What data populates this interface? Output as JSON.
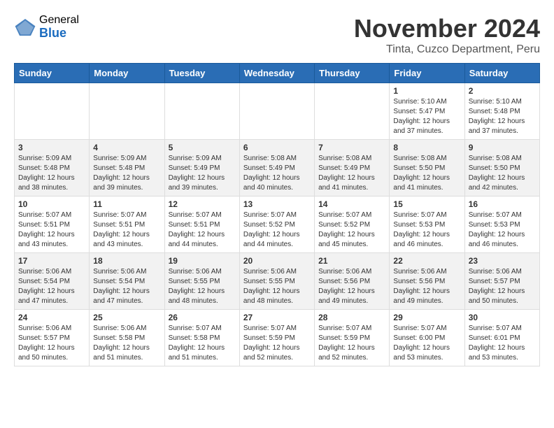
{
  "header": {
    "logo_general": "General",
    "logo_blue": "Blue",
    "title": "November 2024",
    "subtitle": "Tinta, Cuzco Department, Peru"
  },
  "weekdays": [
    "Sunday",
    "Monday",
    "Tuesday",
    "Wednesday",
    "Thursday",
    "Friday",
    "Saturday"
  ],
  "weeks": [
    [
      {
        "day": "",
        "info": ""
      },
      {
        "day": "",
        "info": ""
      },
      {
        "day": "",
        "info": ""
      },
      {
        "day": "",
        "info": ""
      },
      {
        "day": "",
        "info": ""
      },
      {
        "day": "1",
        "info": "Sunrise: 5:10 AM\nSunset: 5:47 PM\nDaylight: 12 hours\nand 37 minutes."
      },
      {
        "day": "2",
        "info": "Sunrise: 5:10 AM\nSunset: 5:48 PM\nDaylight: 12 hours\nand 37 minutes."
      }
    ],
    [
      {
        "day": "3",
        "info": "Sunrise: 5:09 AM\nSunset: 5:48 PM\nDaylight: 12 hours\nand 38 minutes."
      },
      {
        "day": "4",
        "info": "Sunrise: 5:09 AM\nSunset: 5:48 PM\nDaylight: 12 hours\nand 39 minutes."
      },
      {
        "day": "5",
        "info": "Sunrise: 5:09 AM\nSunset: 5:49 PM\nDaylight: 12 hours\nand 39 minutes."
      },
      {
        "day": "6",
        "info": "Sunrise: 5:08 AM\nSunset: 5:49 PM\nDaylight: 12 hours\nand 40 minutes."
      },
      {
        "day": "7",
        "info": "Sunrise: 5:08 AM\nSunset: 5:49 PM\nDaylight: 12 hours\nand 41 minutes."
      },
      {
        "day": "8",
        "info": "Sunrise: 5:08 AM\nSunset: 5:50 PM\nDaylight: 12 hours\nand 41 minutes."
      },
      {
        "day": "9",
        "info": "Sunrise: 5:08 AM\nSunset: 5:50 PM\nDaylight: 12 hours\nand 42 minutes."
      }
    ],
    [
      {
        "day": "10",
        "info": "Sunrise: 5:07 AM\nSunset: 5:51 PM\nDaylight: 12 hours\nand 43 minutes."
      },
      {
        "day": "11",
        "info": "Sunrise: 5:07 AM\nSunset: 5:51 PM\nDaylight: 12 hours\nand 43 minutes."
      },
      {
        "day": "12",
        "info": "Sunrise: 5:07 AM\nSunset: 5:51 PM\nDaylight: 12 hours\nand 44 minutes."
      },
      {
        "day": "13",
        "info": "Sunrise: 5:07 AM\nSunset: 5:52 PM\nDaylight: 12 hours\nand 44 minutes."
      },
      {
        "day": "14",
        "info": "Sunrise: 5:07 AM\nSunset: 5:52 PM\nDaylight: 12 hours\nand 45 minutes."
      },
      {
        "day": "15",
        "info": "Sunrise: 5:07 AM\nSunset: 5:53 PM\nDaylight: 12 hours\nand 46 minutes."
      },
      {
        "day": "16",
        "info": "Sunrise: 5:07 AM\nSunset: 5:53 PM\nDaylight: 12 hours\nand 46 minutes."
      }
    ],
    [
      {
        "day": "17",
        "info": "Sunrise: 5:06 AM\nSunset: 5:54 PM\nDaylight: 12 hours\nand 47 minutes."
      },
      {
        "day": "18",
        "info": "Sunrise: 5:06 AM\nSunset: 5:54 PM\nDaylight: 12 hours\nand 47 minutes."
      },
      {
        "day": "19",
        "info": "Sunrise: 5:06 AM\nSunset: 5:55 PM\nDaylight: 12 hours\nand 48 minutes."
      },
      {
        "day": "20",
        "info": "Sunrise: 5:06 AM\nSunset: 5:55 PM\nDaylight: 12 hours\nand 48 minutes."
      },
      {
        "day": "21",
        "info": "Sunrise: 5:06 AM\nSunset: 5:56 PM\nDaylight: 12 hours\nand 49 minutes."
      },
      {
        "day": "22",
        "info": "Sunrise: 5:06 AM\nSunset: 5:56 PM\nDaylight: 12 hours\nand 49 minutes."
      },
      {
        "day": "23",
        "info": "Sunrise: 5:06 AM\nSunset: 5:57 PM\nDaylight: 12 hours\nand 50 minutes."
      }
    ],
    [
      {
        "day": "24",
        "info": "Sunrise: 5:06 AM\nSunset: 5:57 PM\nDaylight: 12 hours\nand 50 minutes."
      },
      {
        "day": "25",
        "info": "Sunrise: 5:06 AM\nSunset: 5:58 PM\nDaylight: 12 hours\nand 51 minutes."
      },
      {
        "day": "26",
        "info": "Sunrise: 5:07 AM\nSunset: 5:58 PM\nDaylight: 12 hours\nand 51 minutes."
      },
      {
        "day": "27",
        "info": "Sunrise: 5:07 AM\nSunset: 5:59 PM\nDaylight: 12 hours\nand 52 minutes."
      },
      {
        "day": "28",
        "info": "Sunrise: 5:07 AM\nSunset: 5:59 PM\nDaylight: 12 hours\nand 52 minutes."
      },
      {
        "day": "29",
        "info": "Sunrise: 5:07 AM\nSunset: 6:00 PM\nDaylight: 12 hours\nand 53 minutes."
      },
      {
        "day": "30",
        "info": "Sunrise: 5:07 AM\nSunset: 6:01 PM\nDaylight: 12 hours\nand 53 minutes."
      }
    ]
  ]
}
